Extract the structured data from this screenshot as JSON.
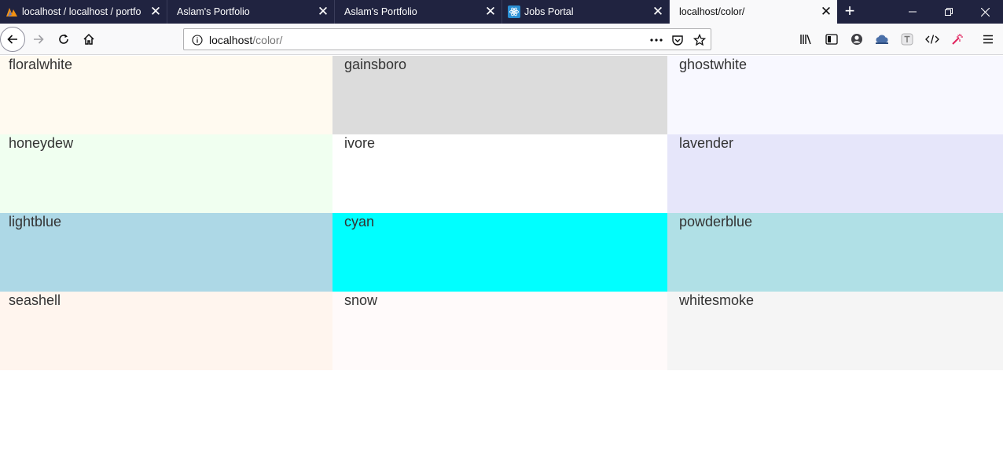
{
  "tabs": [
    {
      "title": "localhost / localhost / portfo",
      "icon": "phpmyadmin-icon",
      "active": false
    },
    {
      "title": "Aslam's Portfolio",
      "icon": "none",
      "active": false
    },
    {
      "title": "Aslam's Portfolio",
      "icon": "none",
      "active": false
    },
    {
      "title": "Jobs Portal",
      "icon": "react-icon",
      "active": false
    },
    {
      "title": "localhost/color/",
      "icon": "none",
      "active": true
    }
  ],
  "url": {
    "host": "localhost",
    "path": "/color/"
  },
  "colors": {
    "tabbar_bg": "#202340",
    "toolbar_bg": "#f9f9fa"
  },
  "swatches": [
    {
      "name": "floralwhite",
      "color": "#fffaf0"
    },
    {
      "name": "gainsboro",
      "color": "#dcdcdc"
    },
    {
      "name": "ghostwhite",
      "color": "#f8f8ff"
    },
    {
      "name": "honeydew",
      "color": "#f0fff0"
    },
    {
      "name": "ivore",
      "color": "#ffffff"
    },
    {
      "name": "lavender",
      "color": "#e6e6fa"
    },
    {
      "name": "lightblue",
      "color": "#add8e6"
    },
    {
      "name": "cyan",
      "color": "#00ffff"
    },
    {
      "name": "powderblue",
      "color": "#b0e0e6"
    },
    {
      "name": "seashell",
      "color": "#fff5ee"
    },
    {
      "name": "snow",
      "color": "#fffafa"
    },
    {
      "name": "whitesmoke",
      "color": "#f5f5f5"
    }
  ]
}
